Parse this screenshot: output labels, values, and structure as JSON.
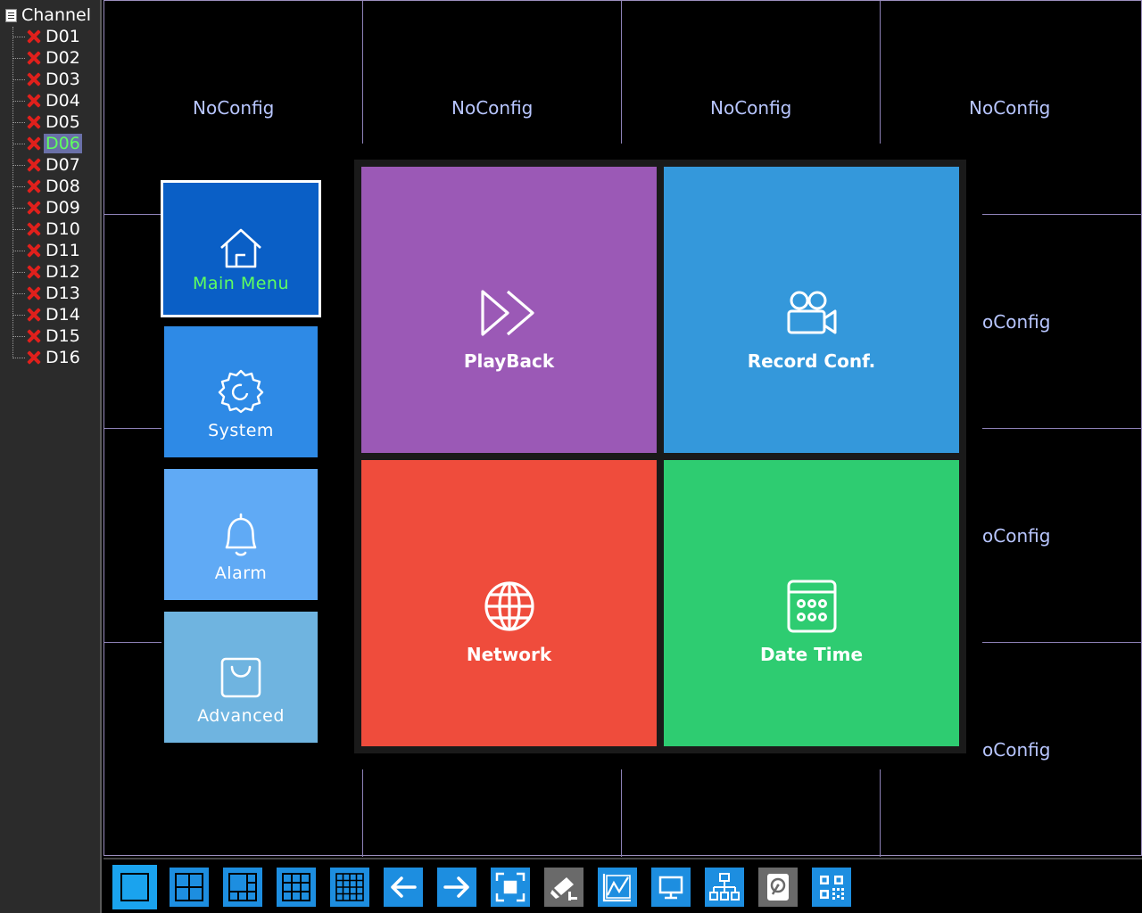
{
  "sidebar": {
    "header": "Channel",
    "channels": [
      {
        "label": "D01",
        "status": "disconnected"
      },
      {
        "label": "D02",
        "status": "disconnected"
      },
      {
        "label": "D03",
        "status": "disconnected"
      },
      {
        "label": "D04",
        "status": "disconnected"
      },
      {
        "label": "D05",
        "status": "disconnected"
      },
      {
        "label": "D06",
        "status": "disconnected",
        "selected": true
      },
      {
        "label": "D07",
        "status": "disconnected"
      },
      {
        "label": "D08",
        "status": "disconnected"
      },
      {
        "label": "D09",
        "status": "disconnected"
      },
      {
        "label": "D10",
        "status": "disconnected"
      },
      {
        "label": "D11",
        "status": "disconnected"
      },
      {
        "label": "D12",
        "status": "disconnected"
      },
      {
        "label": "D13",
        "status": "disconnected"
      },
      {
        "label": "D14",
        "status": "disconnected"
      },
      {
        "label": "D15",
        "status": "disconnected"
      },
      {
        "label": "D16",
        "status": "disconnected"
      }
    ]
  },
  "grid": {
    "cells": [
      "NoConfig",
      "NoConfig",
      "NoConfig",
      "NoConfig",
      "oConfig",
      "oConfig",
      "oConfig"
    ]
  },
  "menu": {
    "side": {
      "main_menu": "Main Menu",
      "system": "System",
      "alarm": "Alarm",
      "advanced": "Advanced"
    },
    "tiles": {
      "playback": "PlayBack",
      "record_conf": "Record Conf.",
      "network": "Network",
      "date_time": "Date Time"
    }
  },
  "toolbar": {
    "buttons": [
      {
        "icon": "single-view-icon"
      },
      {
        "icon": "quad-view-icon"
      },
      {
        "icon": "six-view-icon"
      },
      {
        "icon": "nine-view-icon"
      },
      {
        "icon": "sixteen-view-icon"
      },
      {
        "icon": "previous-arrow-icon"
      },
      {
        "icon": "next-arrow-icon"
      },
      {
        "icon": "fullscreen-icon"
      },
      {
        "icon": "ptz-camera-icon"
      },
      {
        "icon": "chart-icon"
      },
      {
        "icon": "monitor-icon"
      },
      {
        "icon": "network-topology-icon"
      },
      {
        "icon": "hard-disk-icon"
      },
      {
        "icon": "qr-code-icon"
      }
    ]
  },
  "colors": {
    "main_menu_tile": "#0a5fc6",
    "system_tile": "#2e8ae6",
    "alarm_tile": "#60aaf5",
    "advanced_tile": "#6fb4e0",
    "playback_tile": "#9b59b6",
    "record_tile": "#3498db",
    "network_tile": "#ef4c3c",
    "datetime_tile": "#2ecc71",
    "highlight_text": "#5fff5f",
    "grid_text": "#b8c6ff",
    "disconnected_icon": "#e0201c"
  }
}
